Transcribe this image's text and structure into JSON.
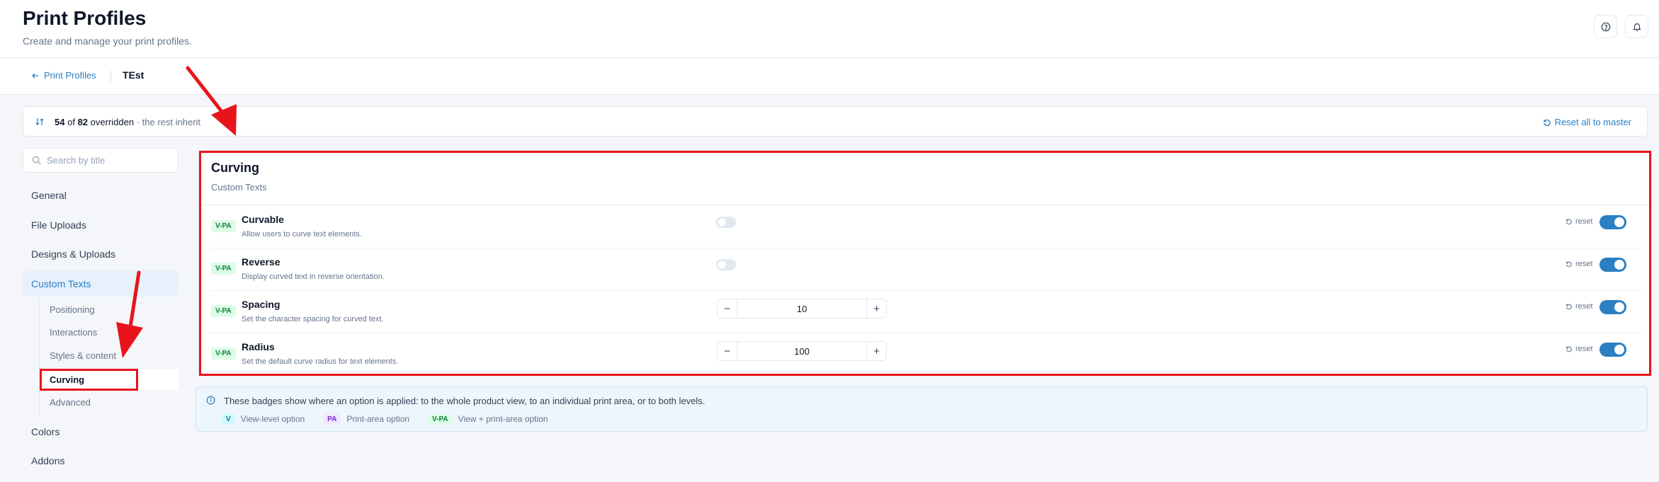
{
  "header": {
    "title": "Print Profiles",
    "subtitle": "Create and manage your print profiles.",
    "help_icon": "help-circle-icon",
    "bell_icon": "bell-icon"
  },
  "breadcrumb": {
    "back_label": "Print Profiles",
    "current": "TEst"
  },
  "override_bar": {
    "count": "54",
    "of_label": "of",
    "total": "82",
    "overridden_label": "overridden",
    "rest_label": "· the rest inherit",
    "reset_all_label": "Reset all to master"
  },
  "search": {
    "placeholder": "Search by title",
    "value": ""
  },
  "sidebar": {
    "items": [
      {
        "label": "General"
      },
      {
        "label": "File Uploads"
      },
      {
        "label": "Designs & Uploads"
      },
      {
        "label": "Custom Texts",
        "active": true
      },
      {
        "label": "Colors"
      },
      {
        "label": "Addons"
      }
    ],
    "sub_items": [
      {
        "label": "Positioning"
      },
      {
        "label": "Interactions"
      },
      {
        "label": "Styles & content"
      },
      {
        "label": "Curving",
        "active": true
      },
      {
        "label": "Advanced"
      }
    ]
  },
  "panel": {
    "title": "Curving",
    "subtitle": "Custom Texts",
    "reset_label": "reset",
    "options": [
      {
        "badge": "V-PA",
        "label": "Curvable",
        "description": "Allow users to curve text elements.",
        "control": "toggle",
        "value_on": false,
        "override_on": true
      },
      {
        "badge": "V-PA",
        "label": "Reverse",
        "description": "Display curved text in reverse orientation.",
        "control": "toggle",
        "value_on": false,
        "override_on": true
      },
      {
        "badge": "V-PA",
        "label": "Spacing",
        "description": "Set the character spacing for curved text.",
        "control": "stepper",
        "value": "10",
        "override_on": true
      },
      {
        "badge": "V-PA",
        "label": "Radius",
        "description": "Set the default curve radius for text elements.",
        "control": "stepper",
        "value": "100",
        "override_on": true
      }
    ]
  },
  "info": {
    "text": "These badges show where an option is applied: to the whole product view, to an individual print area, or to both levels.",
    "legend": [
      {
        "badge": "V",
        "label": "View-level option"
      },
      {
        "badge": "PA",
        "label": "Print-area option"
      },
      {
        "badge": "V-PA",
        "label": "View + print-area option"
      }
    ]
  },
  "colors": {
    "accent": "#2b7fc2",
    "highlight": "#e8141a",
    "badge_vpa_bg": "#dcfce7",
    "badge_vpa_fg": "#15803d"
  }
}
